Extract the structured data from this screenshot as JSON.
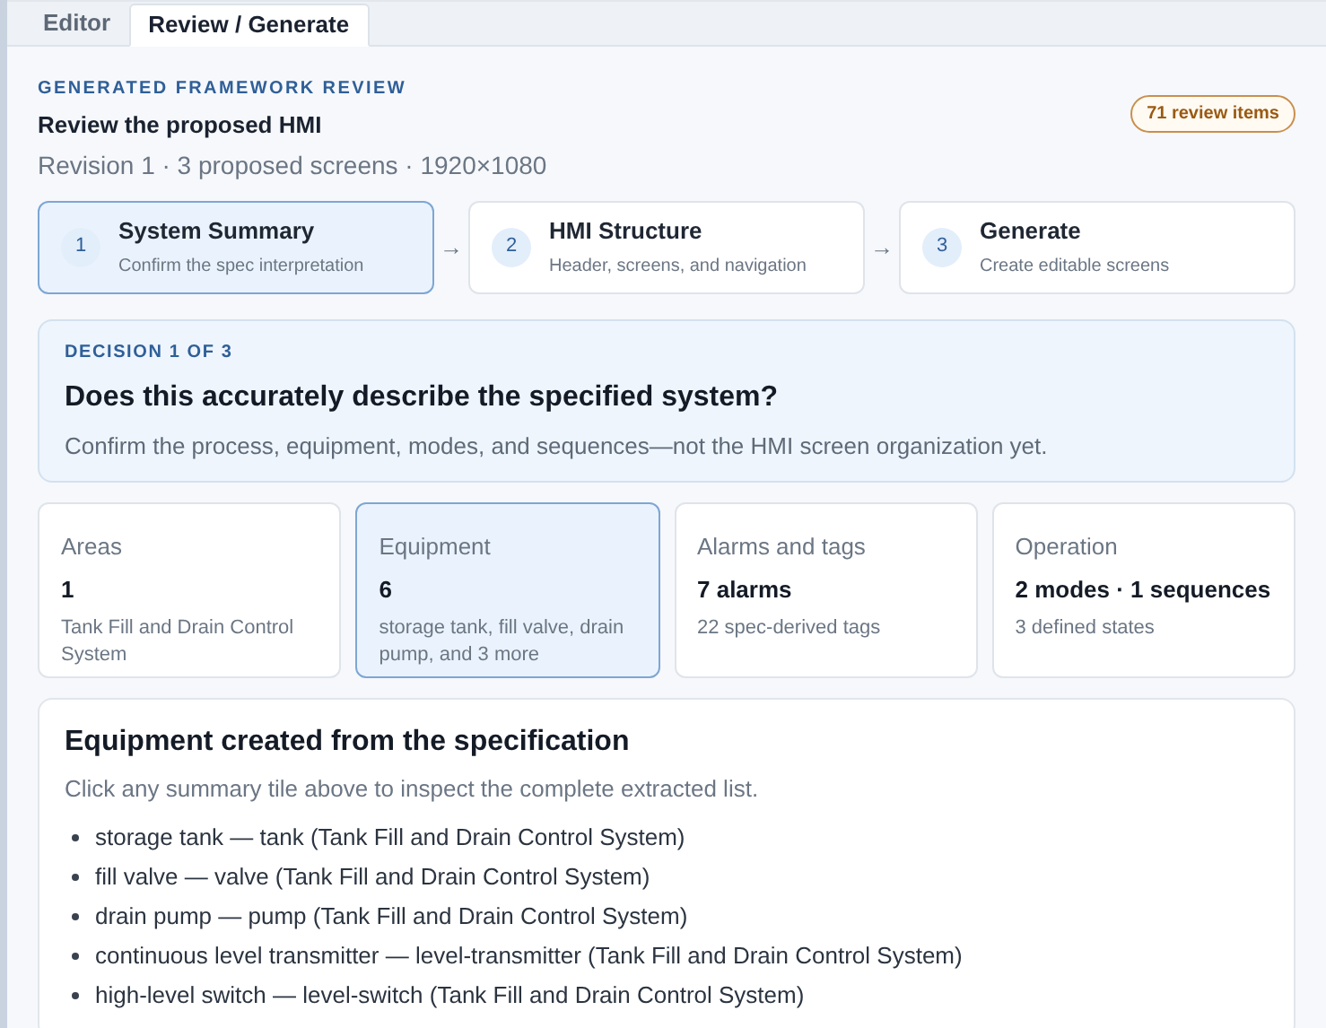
{
  "tabs": [
    {
      "label": "Editor",
      "selected": false
    },
    {
      "label": "Review / Generate",
      "selected": true
    }
  ],
  "header": {
    "eyebrow": "GENERATED FRAMEWORK REVIEW",
    "title": "Review the proposed HMI",
    "subtitle": "Revision 1 · 3 proposed screens · 1920×1080",
    "badge": "71 review items"
  },
  "steps": [
    {
      "number": "1",
      "title": "System Summary",
      "subtitle": "Confirm the spec interpretation",
      "selected": true
    },
    {
      "number": "2",
      "title": "HMI Structure",
      "subtitle": "Header, screens, and navigation",
      "selected": false
    },
    {
      "number": "3",
      "title": "Generate",
      "subtitle": "Create editable screens",
      "selected": false
    }
  ],
  "step_separator": "→",
  "decision": {
    "eyebrow": "DECISION 1 OF 3",
    "question": "Does this accurately describe the specified system?",
    "description": "Confirm the process, equipment, modes, and sequences—not the HMI screen organization yet."
  },
  "tiles": [
    {
      "label": "Areas",
      "value": "1",
      "detail": "Tank Fill and Drain Control System",
      "selected": false
    },
    {
      "label": "Equipment",
      "value": "6",
      "detail": "storage tank, fill valve, drain pump, and 3 more",
      "selected": true
    },
    {
      "label": "Alarms and tags",
      "value": "7 alarms",
      "detail": "22 spec-derived tags",
      "selected": false
    },
    {
      "label": "Operation",
      "value": "2 modes · 1 sequences",
      "detail": "3 defined states",
      "selected": false
    }
  ],
  "details": {
    "title": "Equipment created from the specification",
    "hint": "Click any summary tile above to inspect the complete extracted list.",
    "items": [
      "storage tank — tank (Tank Fill and Drain Control System)",
      "fill valve — valve (Tank Fill and Drain Control System)",
      "drain pump — pump (Tank Fill and Drain Control System)",
      "continuous level transmitter — level-transmitter (Tank Fill and Drain Control System)",
      "high-level switch — level-switch (Tank Fill and Drain Control System)"
    ]
  }
}
